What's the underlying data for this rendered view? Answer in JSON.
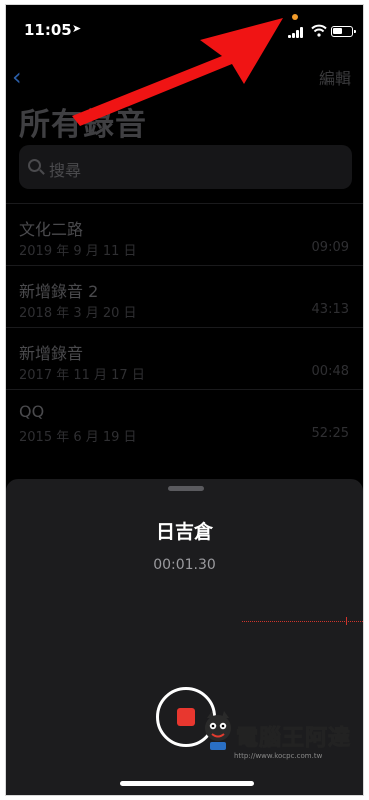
{
  "status_bar": {
    "time": "11:05"
  },
  "nav": {
    "back_icon": "chevron-left-icon",
    "edit_label": "編輯"
  },
  "page_title": "所有錄音",
  "search": {
    "placeholder": "搜尋"
  },
  "recordings": [
    {
      "title": "文化二路",
      "date": "2019 年 9 月 11 日",
      "duration": "09:09"
    },
    {
      "title": "新增錄音 2",
      "date": "2018 年 3 月 20 日",
      "duration": "43:13"
    },
    {
      "title": "新增錄音",
      "date": "2017 年 11 月 17 日",
      "duration": "00:48"
    },
    {
      "title": "QQ",
      "date": "2015 年 6 月 19 日",
      "duration": "52:25"
    }
  ],
  "recording_sheet": {
    "title": "日吉倉",
    "timer": "00:01.30"
  },
  "watermark": {
    "text": "電腦王阿達",
    "url": "http://www.kocpc.com.tw"
  },
  "colors": {
    "accent_blue": "#2b5ea8",
    "record_red": "#e8372f",
    "mic_indicator": "#f39c2b",
    "annotation_arrow": "#f01414"
  }
}
